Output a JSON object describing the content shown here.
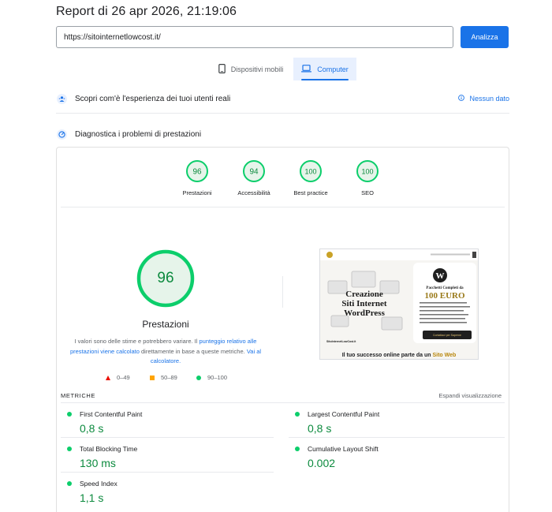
{
  "report": {
    "title": "Report di 26 apr 2026, 21:19:06"
  },
  "search": {
    "url": "https://sitointernetlowcost.it/",
    "analyze_label": "Analizza"
  },
  "device_tabs": [
    {
      "label": "Dispositivi mobili",
      "icon": "smartphone-icon",
      "active": false
    },
    {
      "label": "Computer",
      "icon": "laptop-icon",
      "active": true
    }
  ],
  "field_data": {
    "title": "Scopri com'è l'esperienza dei tuoi utenti reali",
    "status": "Nessun dato"
  },
  "diagnostics": {
    "title": "Diagnostica i problemi di prestazioni"
  },
  "categories": [
    {
      "label": "Prestazioni",
      "score": "96"
    },
    {
      "label": "Accessibilità",
      "score": "94"
    },
    {
      "label": "Best practice",
      "score": "100"
    },
    {
      "label": "SEO",
      "score": "100"
    }
  ],
  "performance": {
    "score": "96",
    "label": "Prestazioni",
    "disclaimer_pre": "I valori sono delle stime e potrebbero variare. Il ",
    "disclaimer_link1": "punteggio relativo alle prestazioni viene calcolato",
    "disclaimer_mid": " direttamente in base a queste metriche. ",
    "disclaimer_link2": "Vai al calcolatore."
  },
  "legend": [
    {
      "range": "0–49",
      "color": "#eb0f00"
    },
    {
      "range": "50–89",
      "color": "#ffa400"
    },
    {
      "range": "90–100",
      "color": "#0cce6b"
    }
  ],
  "screenshot": {
    "headline_1": "Creazione",
    "headline_2": "Siti Internet",
    "headline_3": "WordPress",
    "offer_1": "Pacchetti Completi da",
    "offer_2": "100 EURO",
    "brand": "SitoInternetLowCost.it",
    "cta": "Contattaci per Saperne",
    "caption_pre": "Il tuo successo online parte da un ",
    "caption_gold": "Sito Web"
  },
  "metrics": {
    "title": "METRICHE",
    "expand_label": "Espandi visualizzazione",
    "items": [
      {
        "name": "First Contentful Paint",
        "value": "0,8 s"
      },
      {
        "name": "Largest Contentful Paint",
        "value": "0,8 s"
      },
      {
        "name": "Total Blocking Time",
        "value": "130 ms"
      },
      {
        "name": "Cumulative Layout Shift",
        "value": "0.002"
      },
      {
        "name": "Speed Index",
        "value": "1,1 s"
      }
    ]
  },
  "colors": {
    "accent": "#1a73e8",
    "good": "#0cce6b",
    "good_text": "#0c8a3e",
    "good_fill": "#e6f4ea"
  }
}
